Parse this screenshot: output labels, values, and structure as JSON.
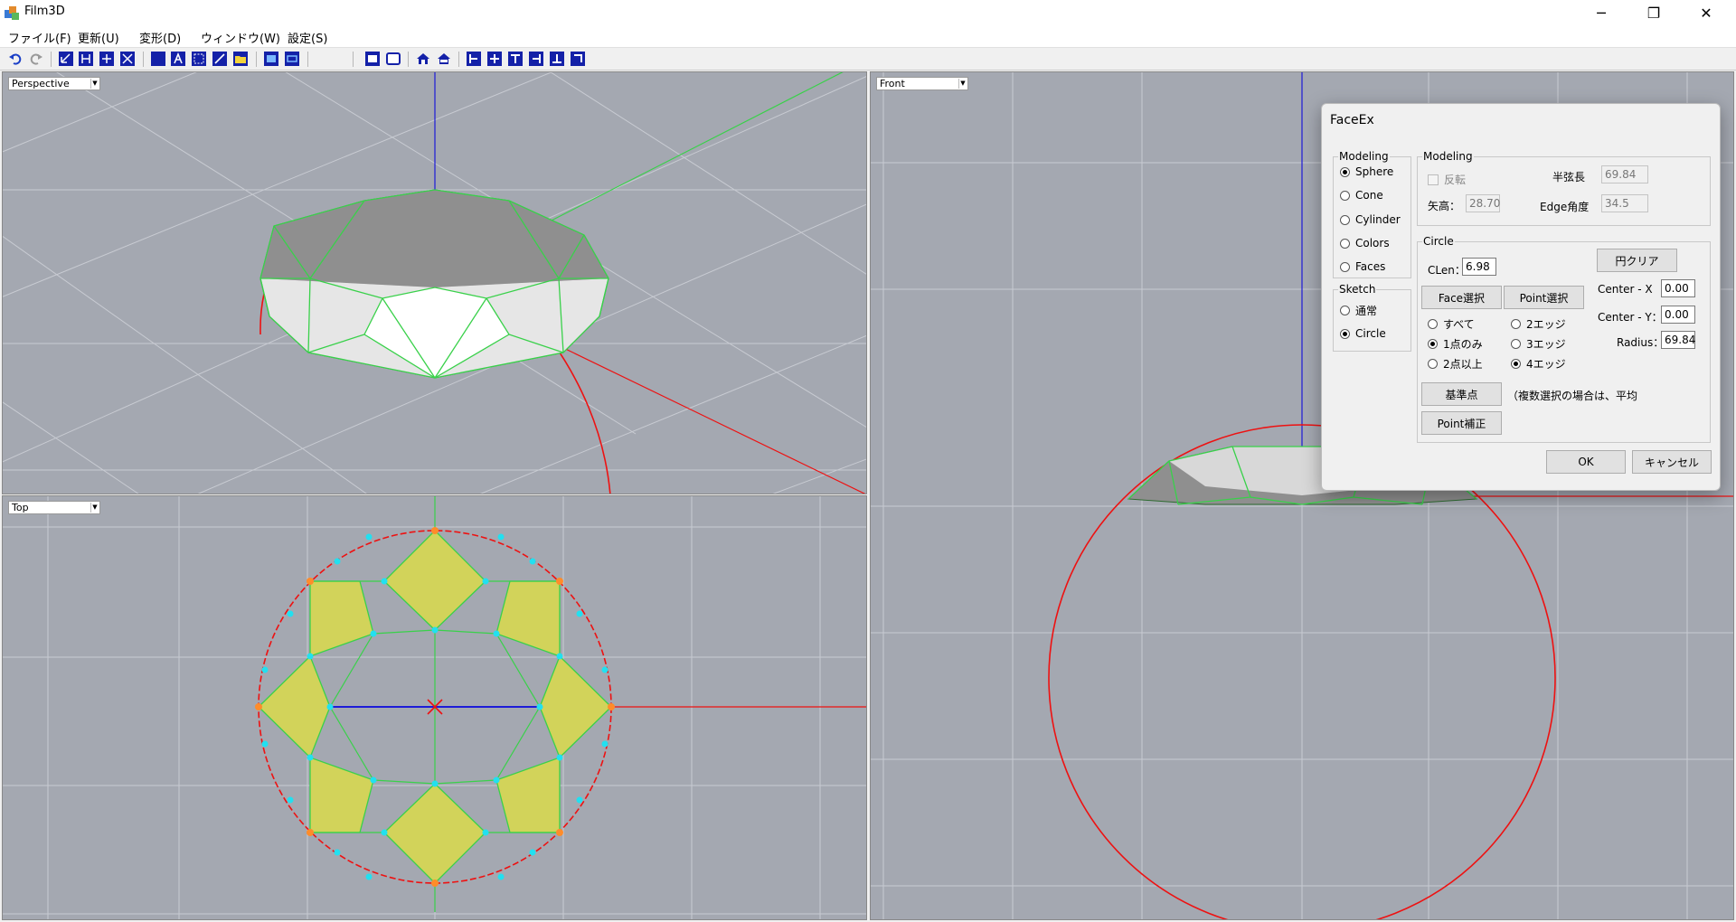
{
  "app": {
    "title": "Film3D"
  },
  "window_controls": {
    "minimize": "─",
    "restore": "❐",
    "close": "✕"
  },
  "menu": [
    "ファイル(F)",
    "更新(U)",
    "変形(D)",
    "ウィンドウ(W)",
    "設定(S)"
  ],
  "views": {
    "perspective": "Perspective",
    "front": "Front",
    "top": "Top"
  },
  "colors": {
    "viewport_bg": "#a4a8b1",
    "mesh": "#39d14a",
    "circle": "#ee1111",
    "vertex": "#22e0f0",
    "face_fill": "#d2d35a"
  },
  "dialog": {
    "title": "FaceEx",
    "modeling_group": "Modeling",
    "modeling_options": [
      "Sphere",
      "Cone",
      "Cylinder",
      "Colors",
      "Faces"
    ],
    "modeling_selected": "Sphere",
    "sketch_group": "Sketch",
    "sketch_options": [
      "通常",
      "Circle"
    ],
    "sketch_selected": "Circle",
    "params_group": "Modeling",
    "invert_label": "反転",
    "half_chord_label": "半弦長",
    "half_chord_value": "69.84",
    "sagitta_label": "矢高：",
    "sagitta_value": "28.70",
    "edge_angle_label": "Edge角度",
    "edge_angle_value": "34.5",
    "circle_group": "Circle",
    "clen_label": "CLen：",
    "clen_value": "6.98",
    "clear_circle_button": "円クリア",
    "face_select_button": "Face選択",
    "point_select_button": "Point選択",
    "center_x_label": "Center - X",
    "center_x_value": "0.00",
    "center_y_label": "Center - Y：",
    "center_y_value": "0.00",
    "radius_label": "Radius：",
    "radius_value": "69.84",
    "point_options": [
      "すべて",
      "1点のみ",
      "2点以上"
    ],
    "point_selected": "1点のみ",
    "edge_options": [
      "2エッジ",
      "3エッジ",
      "4エッジ"
    ],
    "edge_selected": "4エッジ",
    "base_point_button": "基準点",
    "note": "（複数選択の場合は、平均",
    "point_correct_button": "Point補正",
    "ok_button": "OK",
    "cancel_button": "キャンセル"
  }
}
